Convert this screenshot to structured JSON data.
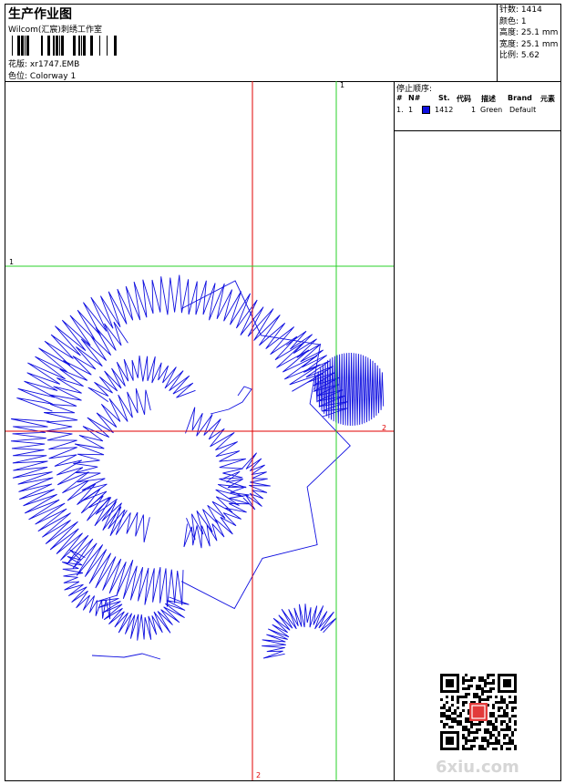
{
  "header": {
    "title": "生产作业图",
    "studio": "Wilcom(汇宸)刺绣工作室",
    "design_label": "花版:",
    "design_file": "xr1747.EMB",
    "colorway_label": "色位:",
    "colorway": "Colorway 1"
  },
  "stats": [
    {
      "label": "针数:",
      "value": "1414"
    },
    {
      "label": "颜色:",
      "value": "1"
    },
    {
      "label": "高度:",
      "value": "25.1 mm"
    },
    {
      "label": "宽度:",
      "value": "25.1 mm"
    },
    {
      "label": "比例:",
      "value": "5.62"
    }
  ],
  "stop_sequence": {
    "title": "停止顺序:",
    "columns": [
      "#",
      "N#",
      "St.",
      "代码",
      "描述",
      "Brand",
      "元素"
    ],
    "rows": [
      {
        "index": "1.",
        "needle": "1",
        "stitches": "1412",
        "code": "1",
        "description": "Green",
        "brand": "Default",
        "swatch_color": "#1010e0"
      }
    ]
  },
  "canvas_marks": {
    "h1": "1",
    "v1": "1",
    "h2": "2",
    "v2": "2"
  },
  "colors": {
    "stitch": "#1010e0",
    "guide_red": "#e00000",
    "guide_green": "#2ad12a"
  },
  "watermark": "6xiu.com"
}
